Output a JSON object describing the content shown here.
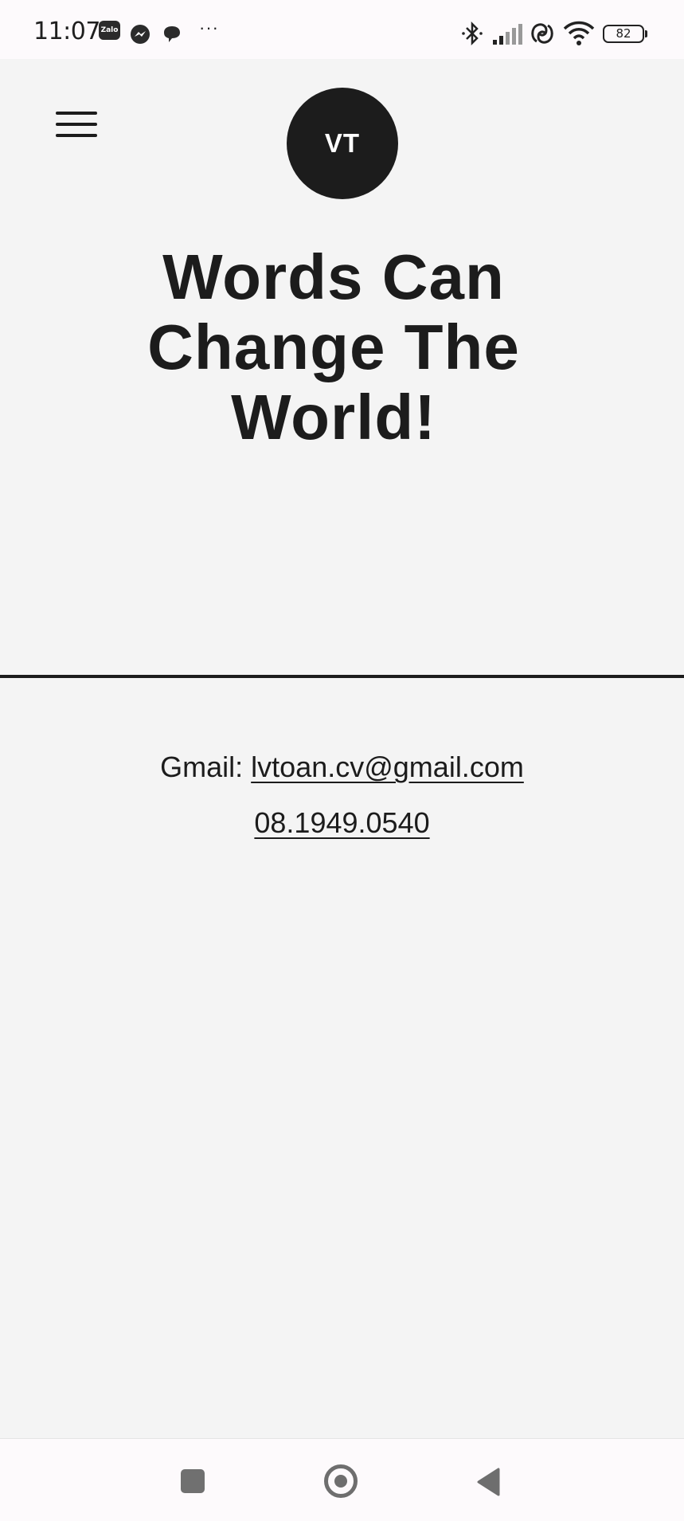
{
  "status_bar": {
    "time": "11:07",
    "notification_icons": [
      "zalo-icon",
      "messenger-icon",
      "chat-bubble-icon"
    ],
    "more_indicator": "···",
    "system_icons": [
      "bluetooth-icon",
      "signal-icon",
      "hotspot-icon",
      "wifi-icon"
    ],
    "battery_level": "82"
  },
  "header": {
    "menu_icon": "hamburger-menu-icon",
    "logo_text": "VT"
  },
  "hero": {
    "headline": "Words Can Change The World!"
  },
  "contact": {
    "email_label": "Gmail: ",
    "email": "lvtoan.cv@gmail.com",
    "phone": "08.1949.0540"
  },
  "nav_bar": {
    "buttons": [
      "recent-apps-icon",
      "home-icon",
      "back-icon"
    ]
  },
  "colors": {
    "background": "#f4f4f4",
    "text": "#1c1c1c",
    "bars": "#fdfafc"
  }
}
